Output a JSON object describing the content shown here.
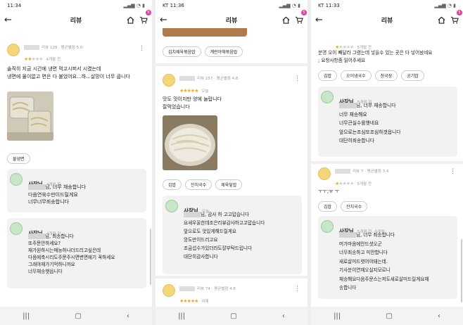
{
  "screens": [
    {
      "status_time": "11:34",
      "carrier": "",
      "title": "리뷰",
      "cart_badge": "5",
      "review": {
        "meta": "리뷰 128 · 평균별점 5.0",
        "date": "4개월 전",
        "rating": 2,
        "text": "솔직히 지금 시간에 냉면 먹고시퍼서 시켰는데\n냉면에 물이없고 면은 다 불었어요...하...살망이 너무 큽니다",
        "chips": [
          "물냉면"
        ]
      },
      "replies": [
        {
          "name": "사장님",
          "date": "4개월 전",
          "text": "님, 너무 채송합니다\n다음연육수만이드릴게요\n너무너무죄송합니다"
        },
        {
          "name": "사장님",
          "date": "4개월 전",
          "text": "님, 죄송합니다\n또주문안하세요?\n재가원하시는매능하나더드리고싶은데\n다음에축시리도주문주시면변면에기 꼭하세요\n그래야재가기억하니까요\n너무채송햇읍니다"
        }
      ]
    },
    {
      "status_time": "11:36",
      "carrier": "KT",
      "title": "리뷰",
      "cart_badge": "5",
      "top_chips": [
        "김치제육볶음밥",
        "계란야채볶음밥"
      ],
      "review": {
        "meta": "리뷰 257 · 평균별점 4.8",
        "date": "오늘",
        "rating": 5,
        "text": "맛도 맛이지만 양에 놀랍니다\n잘먹었습니다",
        "chips": [
          "김밥",
          "잔치국수",
          "제육덮밥"
        ]
      },
      "replies": [
        {
          "name": "사장님",
          "date": "오늘",
          "text": "님, 감사 하 고고맙습니다\n요새우울한데조은리뷰감사하고고맙습니다\n앞으로도 맛있게해드릴게요\n앙도만이드리고요\n조금섭수가있더라도잘부탁드립니다\n대단히감사합니다"
        }
      ],
      "next": {
        "meta": "리뷰 74 · 평균별점 4.8",
        "date": "어제",
        "rating": 5
      }
    },
    {
      "status_time": "11:33",
      "carrier": "KT",
      "title": "리뷰",
      "cart_badge": "5",
      "review": {
        "date": "5개월 전",
        "rating": 1,
        "text": "분명 오이 빼달라 그랬는데 넣을수 있는 곳은 다 넣어놨네요\n; 요청사항좀 읽어주세요",
        "chips": [
          "김밥",
          "오이냉국수",
          "청국장",
          "공기밥"
        ]
      },
      "replies": [
        {
          "name": "사장님",
          "date": "5개월 전",
          "text": "님, 너무 채송합니다\n너무 채송해요\n너무큰실수를햇네요\n앞으로는조심또조심하갯읍니다\n대단히죄송합니다"
        }
      ],
      "review2": {
        "meta": "리뷰 7 · 평균별점 3.4",
        "date": "5개월 전",
        "rating": 1,
        "text": "ㅜㅜ;ㅠ ㅜ",
        "chips": [
          "김밥",
          "잔치국수"
        ]
      },
      "reply2": {
        "name": "사장님",
        "date": "5개월 전, 수정됨",
        "text": "님, 너무 죄송합니다\n머가마음에안드셧오군\n너무죄송하고 미안합니다\n새로살미드렷어야돼는데.\n기사분이연재오실지모르니\n채송해요다음주문스는저도새로살미드릴게요채\n송합니다"
      }
    }
  ],
  "icons": {
    "back": "arrow-left-icon",
    "home": "home-icon",
    "cart": "cart-icon",
    "more": "more-vert-icon"
  },
  "colors": {
    "star": "#f5a623",
    "badge": "#e040a0",
    "reply_bg": "#f2f2f2"
  }
}
